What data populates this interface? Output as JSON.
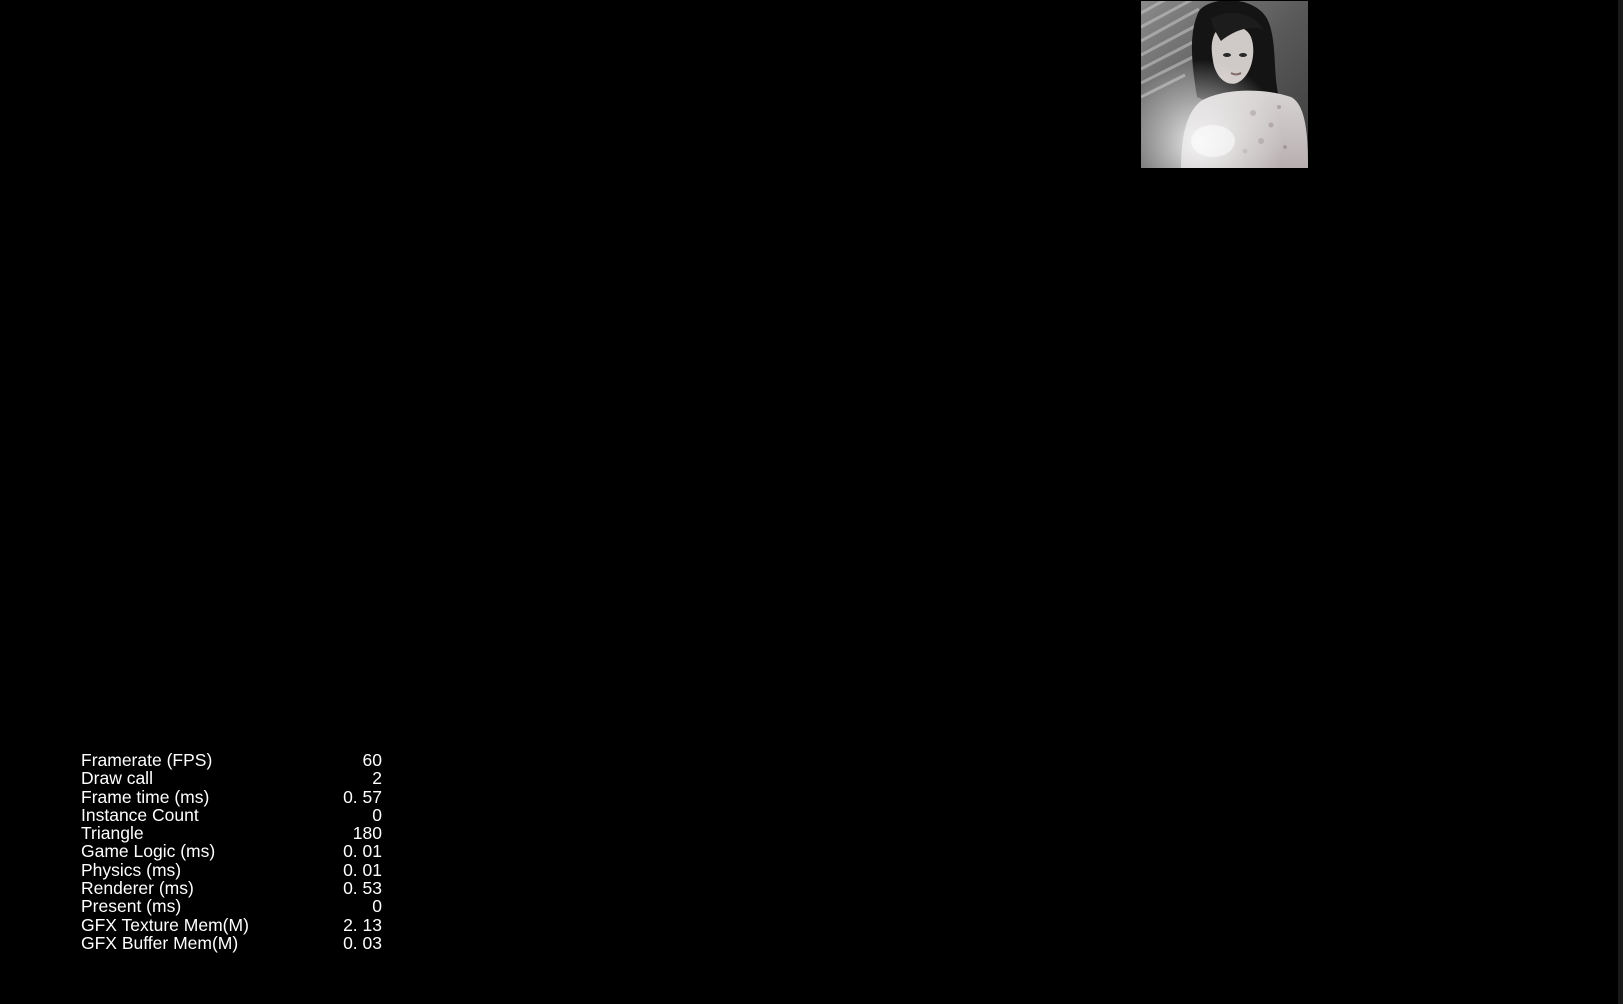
{
  "scene": {
    "background_color": "#000000",
    "sprite": {
      "icon": "portrait-image",
      "description": "grayscale portrait sprite"
    }
  },
  "stats": {
    "text_color": "#ffffff",
    "rows": [
      {
        "label": "Framerate (FPS)",
        "value": "60"
      },
      {
        "label": "Draw call",
        "value": "2"
      },
      {
        "label": "Frame time (ms)",
        "value": "0. 57"
      },
      {
        "label": "Instance Count",
        "value": "0"
      },
      {
        "label": "Triangle",
        "value": "180"
      },
      {
        "label": "Game Logic (ms)",
        "value": "0. 01"
      },
      {
        "label": "Physics (ms)",
        "value": "0. 01"
      },
      {
        "label": "Renderer (ms)",
        "value": "0. 53"
      },
      {
        "label": "Present (ms)",
        "value": "0"
      },
      {
        "label": "GFX Texture Mem(M)",
        "value": "2. 13"
      },
      {
        "label": "GFX Buffer Mem(M)",
        "value": "0. 03"
      }
    ]
  }
}
